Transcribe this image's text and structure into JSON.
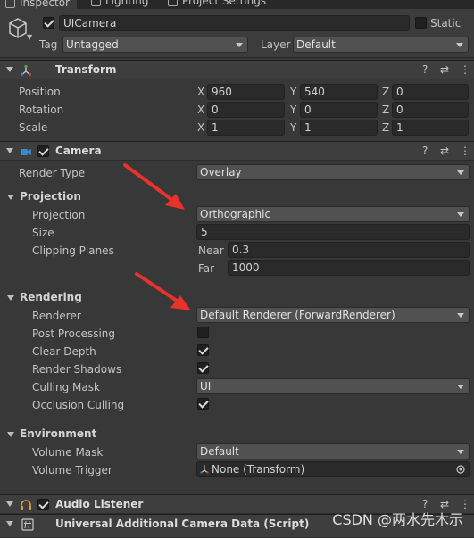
{
  "tabs": [
    {
      "label": "Inspector",
      "active": true
    },
    {
      "label": "Lighting",
      "active": false
    },
    {
      "label": "Project Settings",
      "active": false
    }
  ],
  "gameobject": {
    "name": "UICamera",
    "static_label": "Static",
    "tag_label": "Tag",
    "tag_value": "Untagged",
    "layer_label": "Layer",
    "layer_value": "Default"
  },
  "transform": {
    "title": "Transform",
    "rows": [
      {
        "label": "Position",
        "x": "960",
        "y": "540",
        "z": "0"
      },
      {
        "label": "Rotation",
        "x": "0",
        "y": "0",
        "z": "0"
      },
      {
        "label": "Scale",
        "x": "1",
        "y": "1",
        "z": "1"
      }
    ],
    "axis": {
      "x": "X",
      "y": "Y",
      "z": "Z"
    }
  },
  "camera": {
    "title": "Camera",
    "render_type_label": "Render Type",
    "render_type_value": "Overlay",
    "projection_section": "Projection",
    "projection_label": "Projection",
    "projection_value": "Orthographic",
    "size_label": "Size",
    "size_value": "5",
    "clipping_label": "Clipping Planes",
    "near_label": "Near",
    "near_value": "0.3",
    "far_label": "Far",
    "far_value": "1000",
    "rendering_section": "Rendering",
    "renderer_label": "Renderer",
    "renderer_value": "Default Renderer (ForwardRenderer)",
    "post_processing_label": "Post Processing",
    "clear_depth_label": "Clear Depth",
    "render_shadows_label": "Render Shadows",
    "culling_mask_label": "Culling Mask",
    "culling_mask_value": "UI",
    "occlusion_label": "Occlusion Culling",
    "environment_section": "Environment",
    "volume_mask_label": "Volume Mask",
    "volume_mask_value": "Default",
    "volume_trigger_label": "Volume Trigger",
    "volume_trigger_value": "None (Transform)"
  },
  "audio_listener": {
    "title": "Audio Listener"
  },
  "additional_data": {
    "title": "Universal Additional Camera Data (Script)"
  },
  "watermark": "CSDN @两水先木示",
  "icons": {
    "help": "?",
    "presets": "⇄",
    "menu": "⋮"
  },
  "colors": {
    "accent": "#3a79bb",
    "arrow": "#e8322b"
  }
}
